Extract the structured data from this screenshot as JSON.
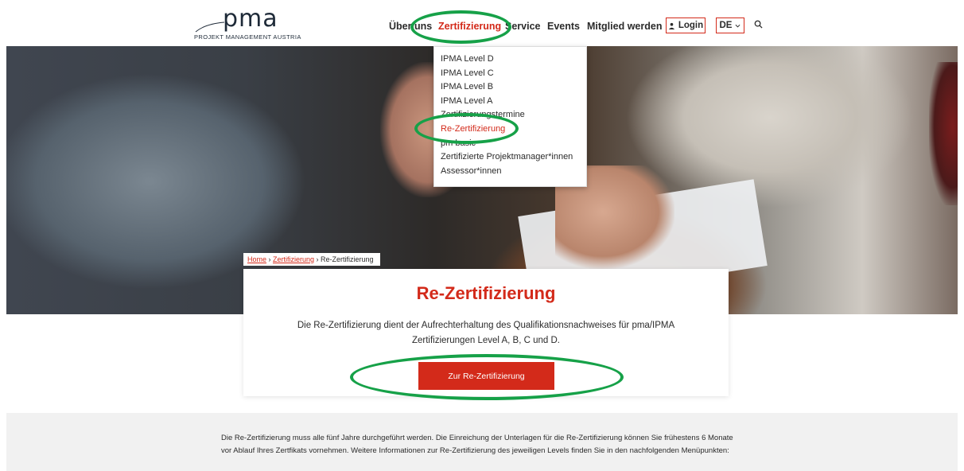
{
  "header": {
    "logo_text": "pma",
    "logo_subtitle": "PROJEKT MANAGEMENT AUSTRIA",
    "nav": [
      {
        "label": "Über uns"
      },
      {
        "label": "Zertifizierung",
        "active": true
      },
      {
        "label": "Service"
      },
      {
        "label": "Events"
      },
      {
        "label": "Mitglied werden"
      }
    ],
    "login_label": "Login",
    "language": "DE",
    "icons": [
      "user-icon",
      "chevron-down-icon",
      "search-icon"
    ],
    "accent_color": "#d32a1a"
  },
  "dropdown": {
    "items": [
      "IPMA Level D",
      "IPMA Level C",
      "IPMA Level B",
      "IPMA Level A",
      "Zertifizierungstermine",
      "Re-Zertifizierung",
      "pm basic",
      "Zertifizierte Projektmanager*innen",
      "Assessor*innen"
    ],
    "active_item": "Re-Zertifizierung"
  },
  "breadcrumb": {
    "home": "Home",
    "separator": " › ",
    "parent": "Zertifizierung",
    "current": "Re-Zertifizierung"
  },
  "card": {
    "title": "Re-Zertifizierung",
    "description": "Die Re-Zertifizierung dient der Aufrechterhaltung des Qualifikationsnachweises für pma/IPMA Zertifizierungen Level A, B, C und D.",
    "cta_label": "Zur Re-Zertifizierung"
  },
  "info": {
    "text": "Die Re-Zertifizierung muss alle fünf Jahre durchgeführt werden. Die Einreichung der Unterlagen für die Re-Zertifizierung können Sie frühestens 6 Monate vor Ablauf Ihres Zertfikats vornehmen. Weitere Informationen zur Re-Zertifizierung des jeweiligen Levels finden Sie in den nachfolgenden Menüpunkten:"
  },
  "annotation_color": "#16a148"
}
